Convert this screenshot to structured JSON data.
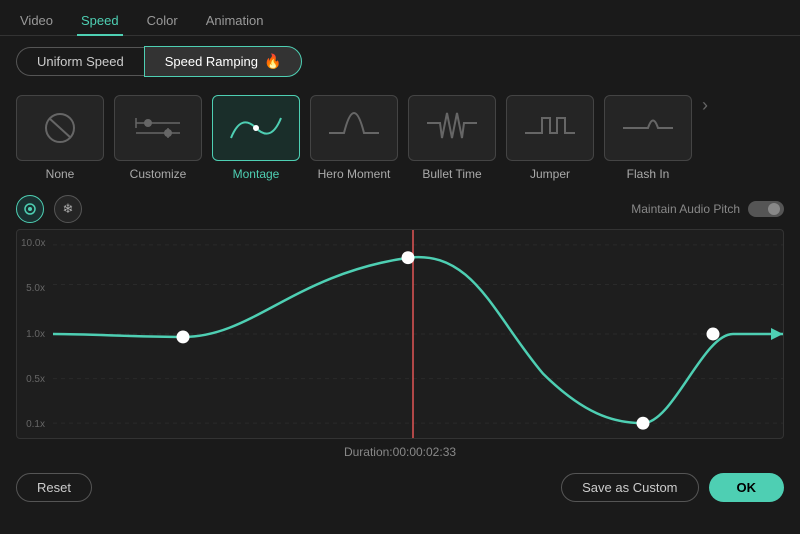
{
  "topTabs": {
    "items": [
      "Video",
      "Speed",
      "Color",
      "Animation"
    ],
    "activeIndex": 1
  },
  "modeTabs": {
    "uniform": "Uniform Speed",
    "ramping": "Speed Ramping",
    "activeMode": "ramping"
  },
  "presets": [
    {
      "id": "none",
      "label": "None",
      "icon": "none",
      "selected": false
    },
    {
      "id": "customize",
      "label": "Customize",
      "icon": "customize",
      "selected": false
    },
    {
      "id": "montage",
      "label": "Montage",
      "icon": "montage",
      "selected": true
    },
    {
      "id": "hero-moment",
      "label": "Hero Moment",
      "icon": "hero-moment",
      "selected": false
    },
    {
      "id": "bullet-time",
      "label": "Bullet Time",
      "icon": "bullet-time",
      "selected": false
    },
    {
      "id": "jumper",
      "label": "Jumper",
      "icon": "jumper",
      "selected": false
    },
    {
      "id": "flash-in",
      "label": "Flash In",
      "icon": "flash-in",
      "selected": false
    }
  ],
  "controls": {
    "curveBtn": "⟳",
    "snowflakeBtn": "❄",
    "maintainLabel": "Maintain Audio Pitch"
  },
  "graph": {
    "yLabels": [
      "10.0x",
      "5.0x",
      "1.0x",
      "0.5x",
      "0.1x"
    ],
    "duration": "Duration:00:00:02:33",
    "redLineX": 50
  },
  "footer": {
    "resetLabel": "Reset",
    "saveCustomLabel": "Save as Custom",
    "okLabel": "OK"
  }
}
